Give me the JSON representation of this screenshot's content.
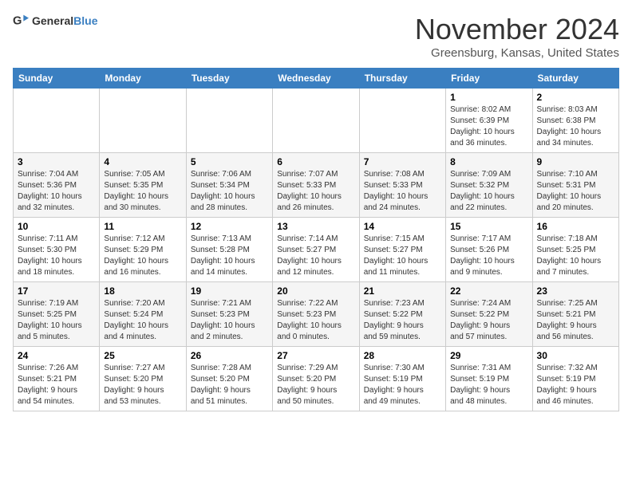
{
  "header": {
    "logo_general": "General",
    "logo_blue": "Blue",
    "month": "November 2024",
    "location": "Greensburg, Kansas, United States"
  },
  "weekdays": [
    "Sunday",
    "Monday",
    "Tuesday",
    "Wednesday",
    "Thursday",
    "Friday",
    "Saturday"
  ],
  "weeks": [
    [
      {
        "day": "",
        "info": ""
      },
      {
        "day": "",
        "info": ""
      },
      {
        "day": "",
        "info": ""
      },
      {
        "day": "",
        "info": ""
      },
      {
        "day": "",
        "info": ""
      },
      {
        "day": "1",
        "info": "Sunrise: 8:02 AM\nSunset: 6:39 PM\nDaylight: 10 hours\nand 36 minutes."
      },
      {
        "day": "2",
        "info": "Sunrise: 8:03 AM\nSunset: 6:38 PM\nDaylight: 10 hours\nand 34 minutes."
      }
    ],
    [
      {
        "day": "3",
        "info": "Sunrise: 7:04 AM\nSunset: 5:36 PM\nDaylight: 10 hours\nand 32 minutes."
      },
      {
        "day": "4",
        "info": "Sunrise: 7:05 AM\nSunset: 5:35 PM\nDaylight: 10 hours\nand 30 minutes."
      },
      {
        "day": "5",
        "info": "Sunrise: 7:06 AM\nSunset: 5:34 PM\nDaylight: 10 hours\nand 28 minutes."
      },
      {
        "day": "6",
        "info": "Sunrise: 7:07 AM\nSunset: 5:33 PM\nDaylight: 10 hours\nand 26 minutes."
      },
      {
        "day": "7",
        "info": "Sunrise: 7:08 AM\nSunset: 5:33 PM\nDaylight: 10 hours\nand 24 minutes."
      },
      {
        "day": "8",
        "info": "Sunrise: 7:09 AM\nSunset: 5:32 PM\nDaylight: 10 hours\nand 22 minutes."
      },
      {
        "day": "9",
        "info": "Sunrise: 7:10 AM\nSunset: 5:31 PM\nDaylight: 10 hours\nand 20 minutes."
      }
    ],
    [
      {
        "day": "10",
        "info": "Sunrise: 7:11 AM\nSunset: 5:30 PM\nDaylight: 10 hours\nand 18 minutes."
      },
      {
        "day": "11",
        "info": "Sunrise: 7:12 AM\nSunset: 5:29 PM\nDaylight: 10 hours\nand 16 minutes."
      },
      {
        "day": "12",
        "info": "Sunrise: 7:13 AM\nSunset: 5:28 PM\nDaylight: 10 hours\nand 14 minutes."
      },
      {
        "day": "13",
        "info": "Sunrise: 7:14 AM\nSunset: 5:27 PM\nDaylight: 10 hours\nand 12 minutes."
      },
      {
        "day": "14",
        "info": "Sunrise: 7:15 AM\nSunset: 5:27 PM\nDaylight: 10 hours\nand 11 minutes."
      },
      {
        "day": "15",
        "info": "Sunrise: 7:17 AM\nSunset: 5:26 PM\nDaylight: 10 hours\nand 9 minutes."
      },
      {
        "day": "16",
        "info": "Sunrise: 7:18 AM\nSunset: 5:25 PM\nDaylight: 10 hours\nand 7 minutes."
      }
    ],
    [
      {
        "day": "17",
        "info": "Sunrise: 7:19 AM\nSunset: 5:25 PM\nDaylight: 10 hours\nand 5 minutes."
      },
      {
        "day": "18",
        "info": "Sunrise: 7:20 AM\nSunset: 5:24 PM\nDaylight: 10 hours\nand 4 minutes."
      },
      {
        "day": "19",
        "info": "Sunrise: 7:21 AM\nSunset: 5:23 PM\nDaylight: 10 hours\nand 2 minutes."
      },
      {
        "day": "20",
        "info": "Sunrise: 7:22 AM\nSunset: 5:23 PM\nDaylight: 10 hours\nand 0 minutes."
      },
      {
        "day": "21",
        "info": "Sunrise: 7:23 AM\nSunset: 5:22 PM\nDaylight: 9 hours\nand 59 minutes."
      },
      {
        "day": "22",
        "info": "Sunrise: 7:24 AM\nSunset: 5:22 PM\nDaylight: 9 hours\nand 57 minutes."
      },
      {
        "day": "23",
        "info": "Sunrise: 7:25 AM\nSunset: 5:21 PM\nDaylight: 9 hours\nand 56 minutes."
      }
    ],
    [
      {
        "day": "24",
        "info": "Sunrise: 7:26 AM\nSunset: 5:21 PM\nDaylight: 9 hours\nand 54 minutes."
      },
      {
        "day": "25",
        "info": "Sunrise: 7:27 AM\nSunset: 5:20 PM\nDaylight: 9 hours\nand 53 minutes."
      },
      {
        "day": "26",
        "info": "Sunrise: 7:28 AM\nSunset: 5:20 PM\nDaylight: 9 hours\nand 51 minutes."
      },
      {
        "day": "27",
        "info": "Sunrise: 7:29 AM\nSunset: 5:20 PM\nDaylight: 9 hours\nand 50 minutes."
      },
      {
        "day": "28",
        "info": "Sunrise: 7:30 AM\nSunset: 5:19 PM\nDaylight: 9 hours\nand 49 minutes."
      },
      {
        "day": "29",
        "info": "Sunrise: 7:31 AM\nSunset: 5:19 PM\nDaylight: 9 hours\nand 48 minutes."
      },
      {
        "day": "30",
        "info": "Sunrise: 7:32 AM\nSunset: 5:19 PM\nDaylight: 9 hours\nand 46 minutes."
      }
    ]
  ]
}
